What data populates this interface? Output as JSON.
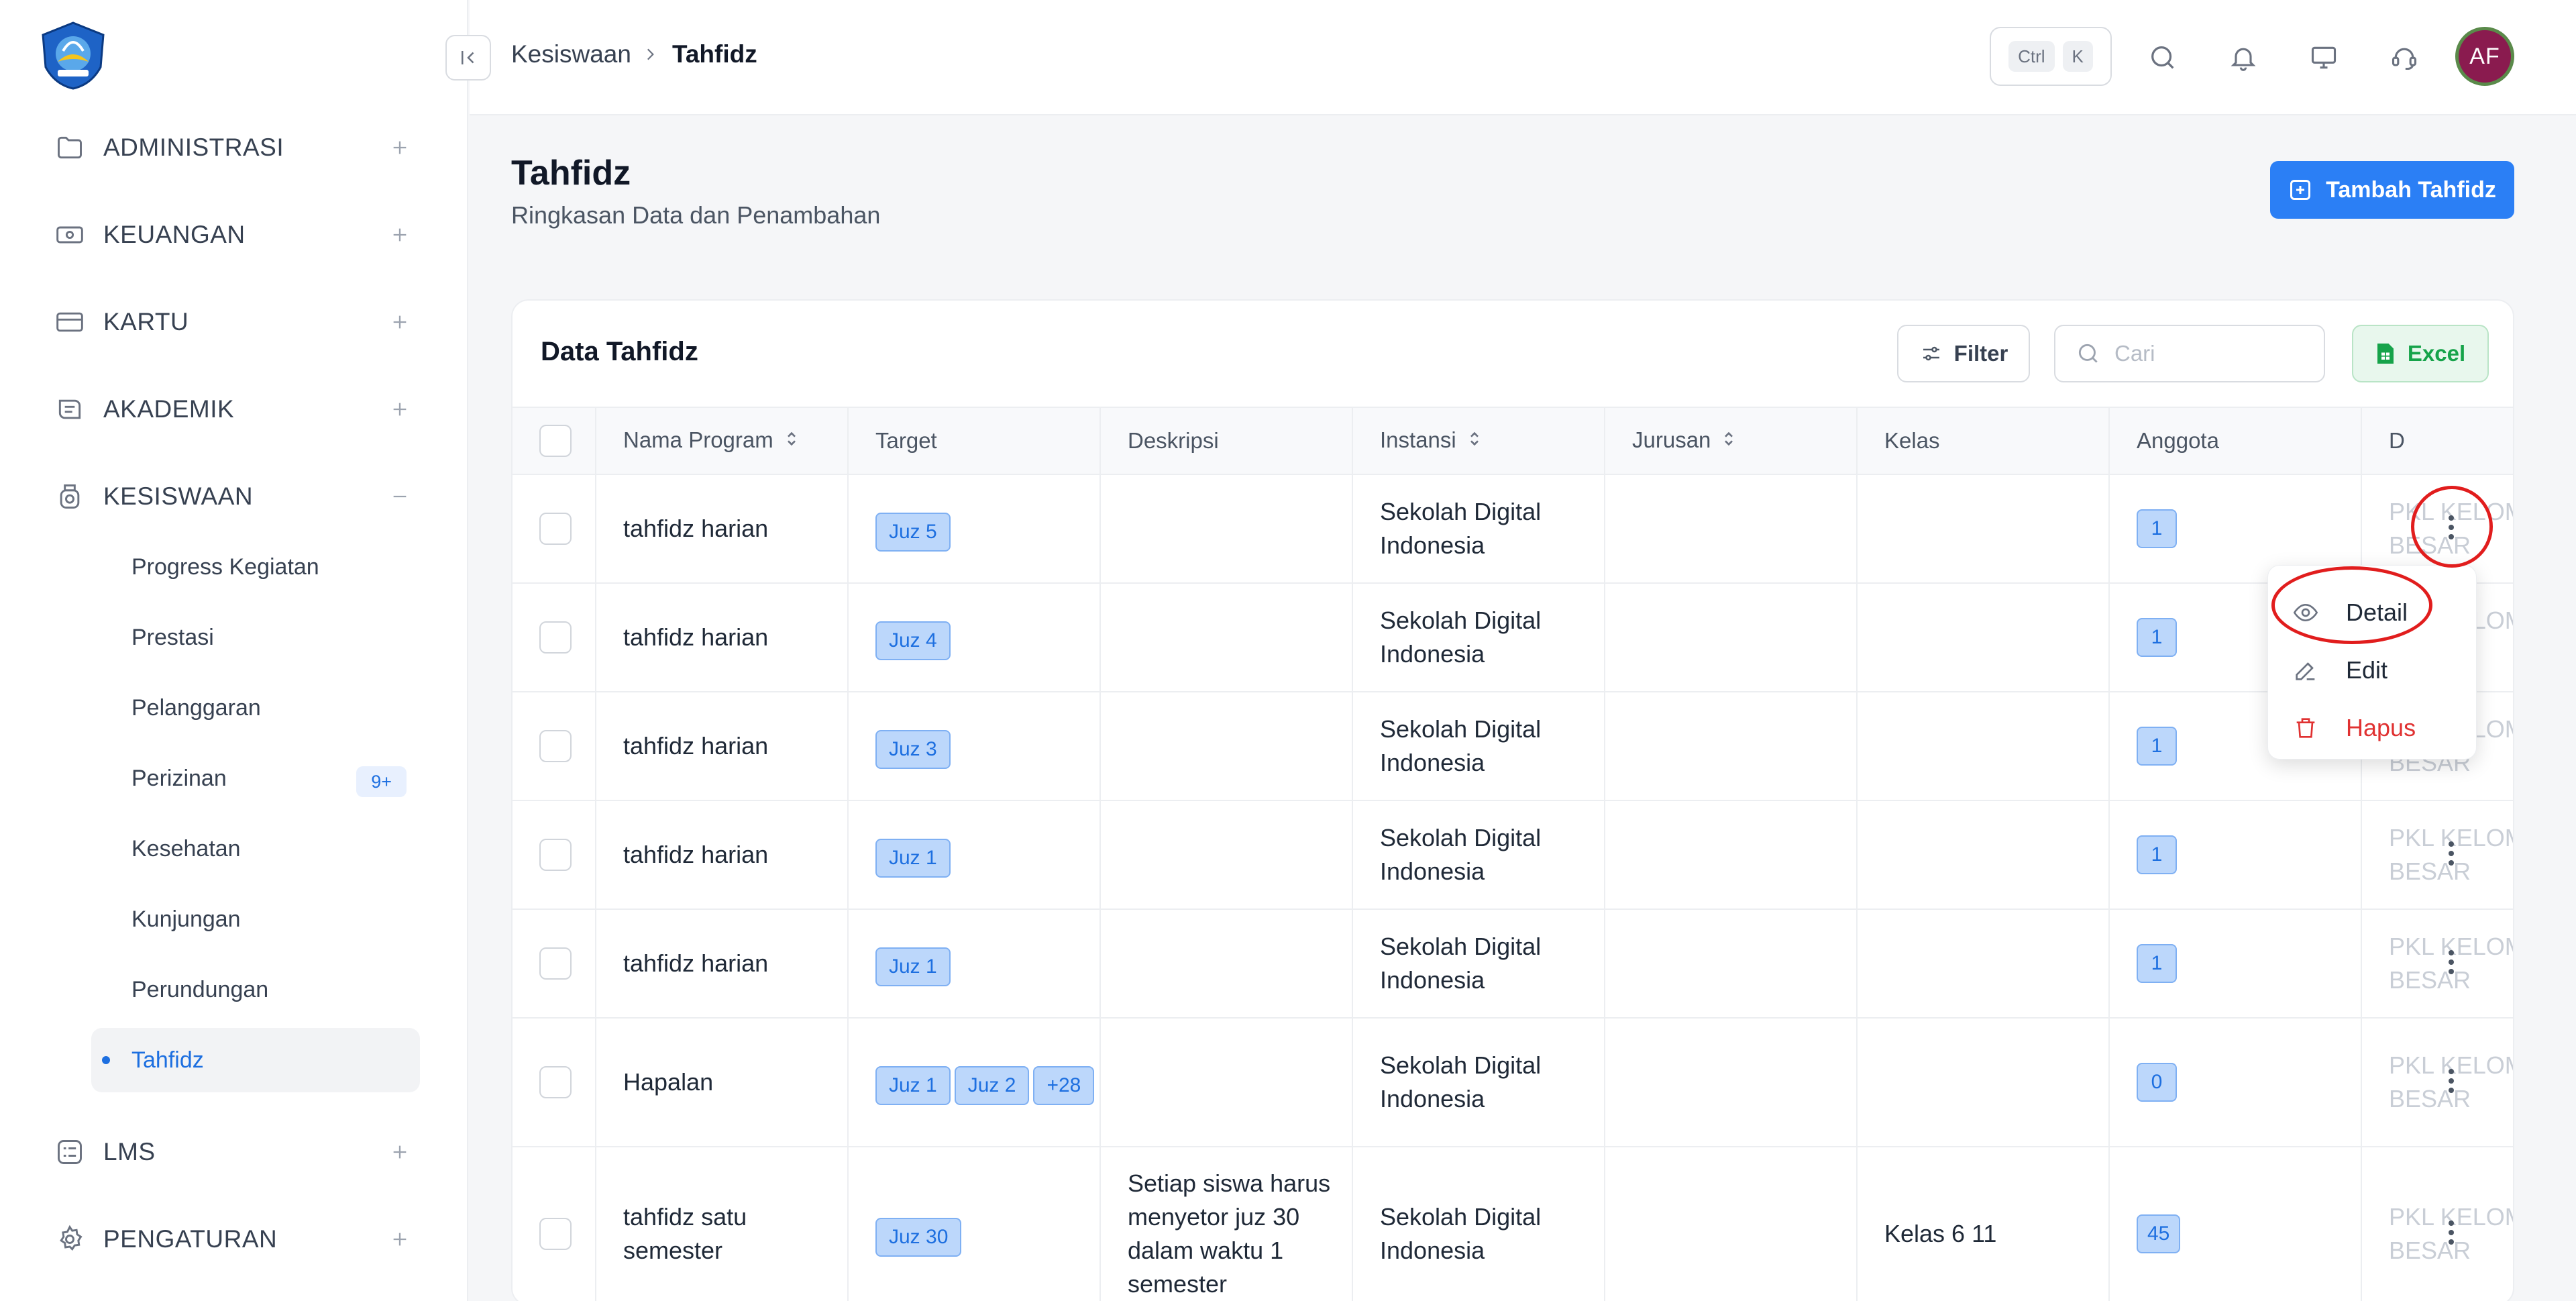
{
  "sidebar": {
    "logo": "tut-wuri-handayani-logo",
    "items": [
      {
        "label": "ADMINISTRASI",
        "icon": "folder-icon",
        "toggle": "+"
      },
      {
        "label": "KEUANGAN",
        "icon": "money-icon",
        "toggle": "+"
      },
      {
        "label": "KARTU",
        "icon": "card-icon",
        "toggle": "+"
      },
      {
        "label": "AKADEMIK",
        "icon": "academic-icon",
        "toggle": "+"
      },
      {
        "label": "KESISWAAN",
        "icon": "student-icon",
        "toggle": "−"
      },
      {
        "label": "LMS",
        "icon": "lms-icon",
        "toggle": "+"
      },
      {
        "label": "PENGATURAN",
        "icon": "gear-icon",
        "toggle": "+"
      }
    ],
    "kesiswaan_sub": [
      {
        "label": "Progress Kegiatan"
      },
      {
        "label": "Prestasi"
      },
      {
        "label": "Pelanggaran"
      },
      {
        "label": "Perizinan",
        "badge": "9+"
      },
      {
        "label": "Kesehatan"
      },
      {
        "label": "Kunjungan"
      },
      {
        "label": "Perundungan"
      },
      {
        "label": "Tahfidz",
        "active": true
      }
    ]
  },
  "topbar": {
    "breadcrumb": [
      "Kesiswaan",
      "Tahfidz"
    ],
    "shortcut": [
      "Ctrl",
      "K"
    ],
    "avatar_initials": "AF"
  },
  "page": {
    "title": "Tahfidz",
    "subtitle": "Ringkasan Data dan Penambahan",
    "add_button": "Tambah Tahfidz"
  },
  "card": {
    "title": "Data Tahfidz",
    "filter_label": "Filter",
    "search_placeholder": "Cari",
    "excel_label": "Excel"
  },
  "table": {
    "columns": [
      "Nama Program",
      "Target",
      "Deskripsi",
      "Instansi",
      "Jurusan",
      "Kelas",
      "Anggota",
      "D"
    ],
    "rows": [
      {
        "nama": "tahfidz harian",
        "target": [
          "Juz 5"
        ],
        "deskripsi": "",
        "instansi": "Sekolah Digital Indonesia",
        "jurusan": "",
        "kelas": "",
        "anggota": "1",
        "last": "PKL KELOMPOK BESAR"
      },
      {
        "nama": "tahfidz harian",
        "target": [
          "Juz 4"
        ],
        "deskripsi": "",
        "instansi": "Sekolah Digital Indonesia",
        "jurusan": "",
        "kelas": "",
        "anggota": "1",
        "last": "PKL KELOMPOK BESAR"
      },
      {
        "nama": "tahfidz harian",
        "target": [
          "Juz 3"
        ],
        "deskripsi": "",
        "instansi": "Sekolah Digital Indonesia",
        "jurusan": "",
        "kelas": "",
        "anggota": "1",
        "last": "PKL KELOMPOK BESAR"
      },
      {
        "nama": "tahfidz harian",
        "target": [
          "Juz 1"
        ],
        "deskripsi": "",
        "instansi": "Sekolah Digital Indonesia",
        "jurusan": "",
        "kelas": "",
        "anggota": "1",
        "last": "PKL KELOMPOK BESAR"
      },
      {
        "nama": "tahfidz harian",
        "target": [
          "Juz 1"
        ],
        "deskripsi": "",
        "instansi": "Sekolah Digital Indonesia",
        "jurusan": "",
        "kelas": "",
        "anggota": "1",
        "last": "PKL KELOMPOK BESAR"
      },
      {
        "nama": "Hapalan",
        "target": [
          "Juz 1",
          "Juz 2",
          "+28"
        ],
        "deskripsi": "",
        "instansi": "Sekolah Digital Indonesia",
        "jurusan": "",
        "kelas": "",
        "anggota": "0",
        "last": "PKL KELOMPOK BESAR"
      },
      {
        "nama": "tahfidz satu semester",
        "target": [
          "Juz 30"
        ],
        "deskripsi": "Setiap siswa harus menyetor juz 30 dalam waktu 1 semester",
        "instansi": "Sekolah Digital Indonesia",
        "jurusan": "",
        "kelas": "Kelas 6 11",
        "anggota": "45",
        "last": "PKL KELOMPOK BESAR"
      }
    ]
  },
  "row_menu": {
    "items": [
      {
        "label": "Detail",
        "icon": "eye-icon"
      },
      {
        "label": "Edit",
        "icon": "edit-icon"
      },
      {
        "label": "Hapus",
        "icon": "trash-icon",
        "danger": true
      }
    ]
  },
  "colors": {
    "primary": "#2b7ff5",
    "danger": "#e03131",
    "success": "#16a34a",
    "annotation": "#e11d1d"
  }
}
